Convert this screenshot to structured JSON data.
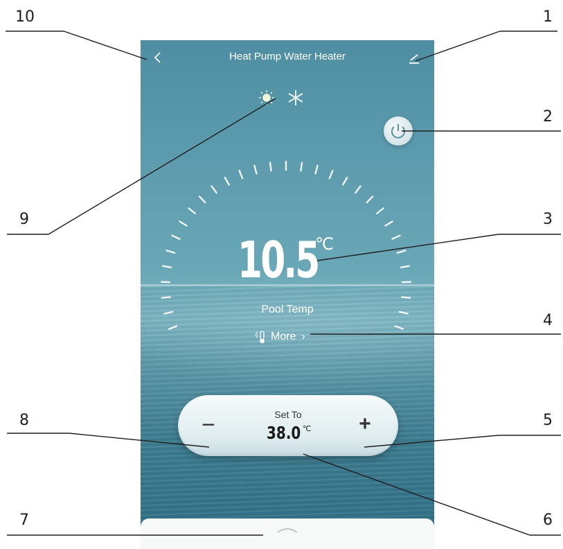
{
  "app": {
    "title": "Heat Pump Water Heater"
  },
  "icons": {
    "back": "chevron-left-icon",
    "edit": "pencil-icon",
    "power": "power-icon",
    "heat_mode": "sun-icon",
    "cool_mode": "snowflake-icon",
    "more": "thermometer-icon",
    "drawer": "chevron-up-icon"
  },
  "current": {
    "temperature": "10.5",
    "unit": "℃",
    "label": "Pool Temp",
    "more_label": "More",
    "more_arrow": "›"
  },
  "setpoint": {
    "label": "Set To",
    "value": "38.0",
    "unit": "℃",
    "minus": "−",
    "plus": "+"
  },
  "callouts": [
    "1",
    "2",
    "3",
    "4",
    "5",
    "6",
    "7",
    "8",
    "9",
    "10"
  ],
  "colors": {
    "sky": "#5c9aad",
    "sea": "#2f6e84",
    "pill": "#dfecef",
    "text_on_bg": "#ffffff"
  }
}
